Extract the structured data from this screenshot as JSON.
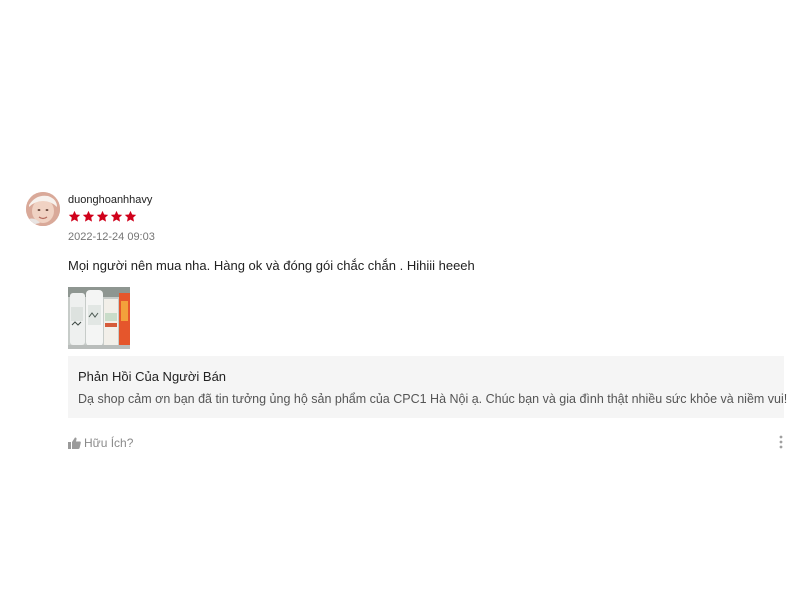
{
  "review": {
    "username": "duonghoanhhavy",
    "rating": 5,
    "rating_max": 5,
    "star_color": "#d0011b",
    "timestamp": "2022-12-24 09:03",
    "comment": "Mọi người nên mua nha. Hàng ok và đóng gói chắc chắn . Hihiii heeeh",
    "avatar_icon": "user-photo",
    "media_icon": "product-photo"
  },
  "seller_reply": {
    "title": "Phản Hồi Của Người Bán",
    "text": "Dạ shop cảm ơn bạn đã tin tưởng ủng hộ sản phẩm của CPC1 Hà Nội ạ. Chúc bạn và gia đình thật nhiều sức khỏe và niềm vui!"
  },
  "actions": {
    "helpful_label": "Hữu Ích?",
    "helpful_icon": "thumbs-up-icon",
    "more_icon": "more-vertical-icon"
  }
}
